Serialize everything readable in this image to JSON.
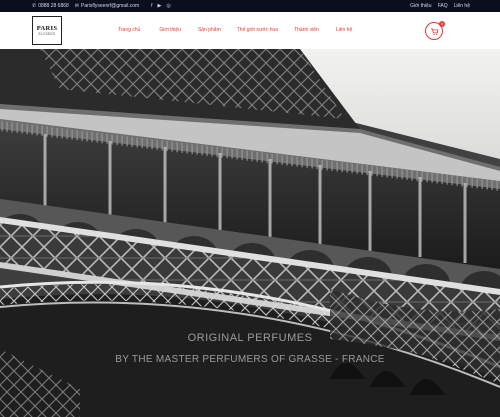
{
  "topbar": {
    "phone": "0888 28 6868",
    "email": "Parisflyseenrf@gmail.com",
    "social_icons": [
      "facebook-icon",
      "youtube-icon",
      "instagram-icon"
    ],
    "links": [
      "Giới thiệu",
      "FAQ",
      "Liên hệ"
    ]
  },
  "brand": {
    "line1": "PARIS",
    "line2": "ELYSEES"
  },
  "nav": {
    "items": [
      "Trang chủ",
      "Giới thiệu",
      "Sản phẩm",
      "Thế giới nước hoa",
      "Thành viên",
      "Liên hệ"
    ]
  },
  "cart": {
    "count": "0"
  },
  "hero": {
    "line1": "ORIGINAL PERFUMES",
    "line2": "BY THE MASTER PERFUMERS OF GRASSE - FRANCE"
  },
  "colors": {
    "accent": "#e53935",
    "topbar": "#0b0f1d"
  }
}
